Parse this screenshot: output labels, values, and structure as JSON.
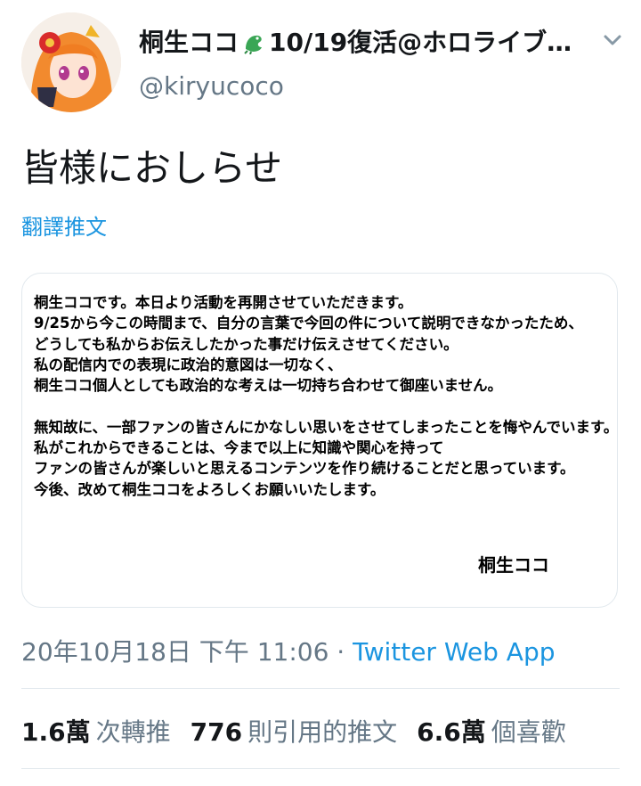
{
  "profile": {
    "display_name": "桐生ココ",
    "name_suffix": "10/19復活@ホロライブ…",
    "handle": "@kiryucoco"
  },
  "icons": [
    "avatar",
    "dragon-emoji-icon",
    "chevron-down-icon"
  ],
  "tweet": {
    "text": "皆様におしらせ",
    "translate_label": "翻譯推文"
  },
  "notice": {
    "lines": [
      "桐生ココです。本日より活動を再開させていただきます。",
      "9/25から今この時間まで、自分の言葉で今回の件について説明できなかったため、",
      "どうしても私からお伝えしたかった事だけ伝えさせてください。",
      "私の配信内での表現に政治的意図は一切なく、",
      "桐生ココ個人としても政治的な考えは一切持ち合わせて御座いません。",
      "",
      "無知故に、一部ファンの皆さんにかなしい思いをさせてしまったことを悔やんでいます。",
      "私がこれからできることは、今まで以上に知識や関心を持って",
      "ファンの皆さんが楽しいと思えるコンテンツを作り続けることだと思っています。",
      "今後、改めて桐生ココをよろしくお願いいたします。"
    ],
    "signature": "桐生ココ"
  },
  "meta": {
    "timestamp": "20年10月18日 下午 11:06",
    "separator": " · ",
    "source_app": "Twitter Web App"
  },
  "stats": {
    "retweets_count": "1.6萬",
    "retweets_label": "次轉推",
    "quotes_count": "776",
    "quotes_label": "則引用的推文",
    "likes_count": "6.6萬",
    "likes_label": "個喜歡"
  },
  "colors": {
    "link": "#1b95e0",
    "secondary": "#657786",
    "divider": "#e1e8ed"
  }
}
